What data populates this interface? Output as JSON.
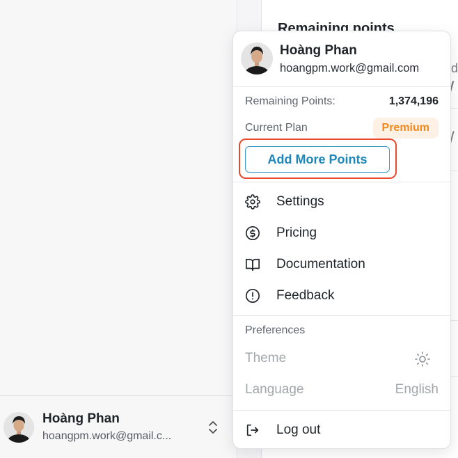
{
  "background": {
    "card_title": "Remaining points",
    "card_fragments": [
      "d",
      "/",
      "/"
    ],
    "sidebar_user": {
      "name": "Hoàng Phan",
      "email": "hoangpm.work@gmail.c..."
    }
  },
  "menu": {
    "user": {
      "name": "Hoàng Phan",
      "email": "hoangpm.work@gmail.com"
    },
    "remaining_label": "Remaining Points:",
    "remaining_value": "1,374,196",
    "plan_label": "Current Plan",
    "plan_badge": "Premium",
    "add_points_label": "Add More Points",
    "items": [
      {
        "label": "Settings",
        "icon": "gear-icon"
      },
      {
        "label": "Pricing",
        "icon": "dollar-circle-icon"
      },
      {
        "label": "Documentation",
        "icon": "book-icon"
      },
      {
        "label": "Feedback",
        "icon": "alert-circle-icon"
      }
    ],
    "preferences": {
      "title": "Preferences",
      "theme_label": "Theme",
      "theme_icon": "sun-icon",
      "language_label": "Language",
      "language_value": "English"
    },
    "logout_label": "Log out"
  },
  "colors": {
    "accent": "#1f86b8",
    "premium": "#f08a20",
    "highlight": "#e8482c"
  }
}
